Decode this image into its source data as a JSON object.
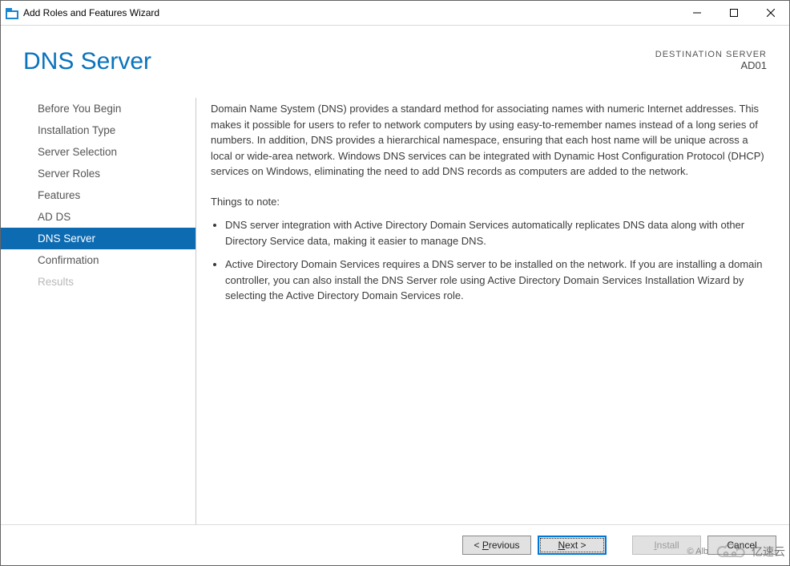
{
  "window": {
    "title": "Add Roles and Features Wizard"
  },
  "header": {
    "page_title": "DNS Server",
    "destination_label": "DESTINATION SERVER",
    "destination_server": "AD01"
  },
  "sidebar": {
    "items": [
      {
        "label": "Before You Begin",
        "active": false,
        "disabled": false
      },
      {
        "label": "Installation Type",
        "active": false,
        "disabled": false
      },
      {
        "label": "Server Selection",
        "active": false,
        "disabled": false
      },
      {
        "label": "Server Roles",
        "active": false,
        "disabled": false
      },
      {
        "label": "Features",
        "active": false,
        "disabled": false
      },
      {
        "label": "AD DS",
        "active": false,
        "disabled": false
      },
      {
        "label": "DNS Server",
        "active": true,
        "disabled": false
      },
      {
        "label": "Confirmation",
        "active": false,
        "disabled": false
      },
      {
        "label": "Results",
        "active": false,
        "disabled": true
      }
    ]
  },
  "content": {
    "intro": "Domain Name System (DNS) provides a standard method for associating names with numeric Internet addresses. This makes it possible for users to refer to network computers by using easy-to-remember names instead of a long series of numbers. In addition, DNS provides a hierarchical namespace, ensuring that each host name will be unique across a local or wide-area network. Windows DNS services can be integrated with Dynamic Host Configuration Protocol (DHCP) services on Windows, eliminating the need to add DNS records as computers are added to the network.",
    "note_heading": "Things to note:",
    "notes": [
      "DNS server integration with Active Directory Domain Services automatically replicates DNS data along with other Directory Service data, making it easier to manage DNS.",
      "Active Directory Domain Services requires a DNS server to be installed on the network. If you are installing a domain controller, you can also install the DNS Server role using Active Directory Domain Services Installation Wizard by selecting the Active Directory Domain Services role."
    ]
  },
  "footer": {
    "previous": {
      "prefix": "< ",
      "underline": "P",
      "rest": "revious"
    },
    "next": {
      "underline": "N",
      "rest": "ext",
      "suffix": " >"
    },
    "install": {
      "underline": "I",
      "rest": "nstall"
    },
    "cancel": {
      "label": "Cancel"
    }
  },
  "watermark": {
    "credit": "© Alb",
    "brand": "亿速云"
  }
}
